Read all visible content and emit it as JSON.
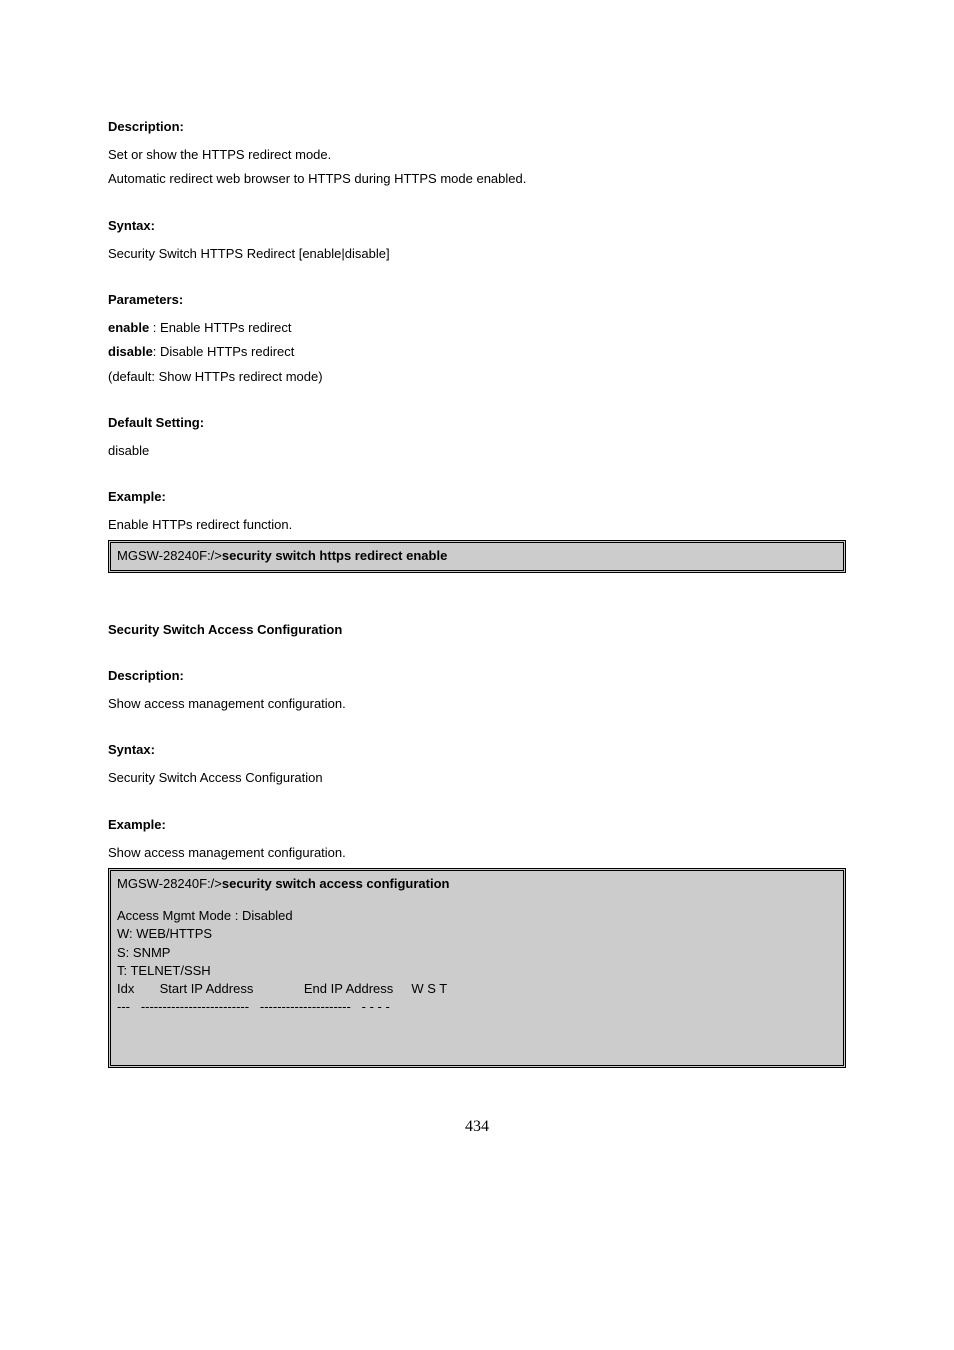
{
  "sec1": {
    "heading_desc": "Description:",
    "desc_line1": "Set or show the HTTPS redirect mode.",
    "desc_line2": "Automatic redirect web browser to HTTPS during HTTPS mode enabled.",
    "heading_syntax": "Syntax:",
    "syntax_line": "Security Switch HTTPS Redirect [enable|disable]",
    "heading_params": "Parameters:",
    "param_enable_key": "enable",
    "param_enable_text": " : Enable HTTPs redirect",
    "param_disable_key": "disable",
    "param_disable_text": ": Disable HTTPs redirect",
    "param_default": "(default: Show HTTPs redirect mode)",
    "heading_default": "Default Setting:",
    "default_value": "disable",
    "heading_example": "Example:",
    "example_desc": "Enable HTTPs redirect function.",
    "codebox_prompt": "MGSW-28240F:/>",
    "codebox_cmd": "security switch https redirect enable"
  },
  "sec2": {
    "topic": "Security Switch Access Configuration",
    "heading_desc": "Description:",
    "desc_line": "Show access management configuration.",
    "heading_syntax": "Syntax:",
    "syntax_line": "Security Switch Access Configuration",
    "heading_example": "Example:",
    "example_desc": "Show access management configuration.",
    "codebox_prompt": "MGSW-28240F:/>",
    "codebox_cmd": "security switch access configuration",
    "out_line1": "Access Mgmt Mode : Disabled",
    "out_line2": "W: WEB/HTTPS",
    "out_line3": "S: SNMP",
    "out_line4": "T: TELNET/SSH",
    "out_line5": "Idx       Start IP Address              End IP Address     W S T",
    "out_line6": "---   -------------------------   ---------------------   - - - -"
  },
  "page_number": "434"
}
